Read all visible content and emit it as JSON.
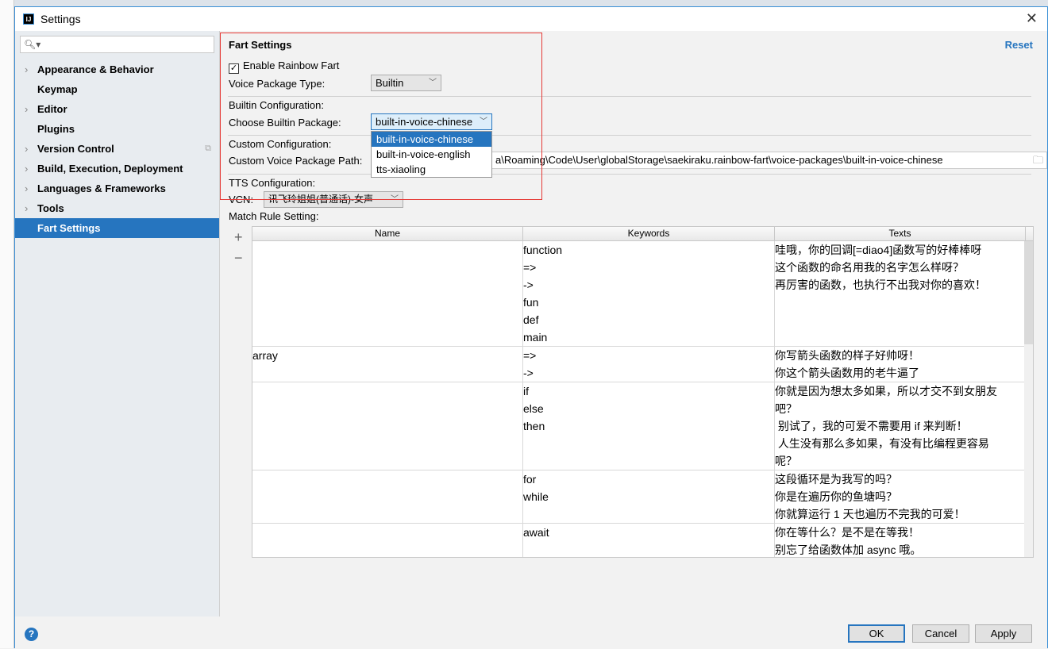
{
  "window": {
    "title": "Settings",
    "app_icon": "IJ"
  },
  "sidebar": {
    "search_placeholder": "",
    "items": [
      {
        "label": "Appearance & Behavior",
        "expandable": true
      },
      {
        "label": "Keymap",
        "expandable": false
      },
      {
        "label": "Editor",
        "expandable": true
      },
      {
        "label": "Plugins",
        "expandable": false
      },
      {
        "label": "Version Control",
        "expandable": true
      },
      {
        "label": "Build, Execution, Deployment",
        "expandable": true
      },
      {
        "label": "Languages & Frameworks",
        "expandable": true
      },
      {
        "label": "Tools",
        "expandable": true
      },
      {
        "label": "Fart Settings",
        "expandable": false,
        "selected": true
      }
    ]
  },
  "main": {
    "section_title": "Fart Settings",
    "reset": "Reset",
    "enable_label": "Enable Rainbow Fart",
    "enable_checked": true,
    "voice_type_label": "Voice Package Type:",
    "voice_type_value": "Builtin",
    "builtin_config_label": "Builtin Configuration:",
    "choose_builtin_label": "Choose Builtin Package:",
    "choose_builtin_value": "built-in-voice-chinese",
    "builtin_options": [
      "built-in-voice-chinese",
      "built-in-voice-english",
      "tts-xiaoling"
    ],
    "custom_config_label": "Custom Configuration:",
    "custom_path_label": "Custom Voice Package Path:",
    "custom_path_value": "a\\Roaming\\Code\\User\\globalStorage\\saekiraku.rainbow-fart\\voice-packages\\built-in-voice-chinese",
    "tts_config_label": "TTS Configuration:",
    "vcn_label": "VCN:",
    "vcn_value": "讯飞玲姐姐(普通话)-女声",
    "match_rule_label": "Match Rule Setting:",
    "add": "+",
    "remove": "−"
  },
  "table": {
    "columns": [
      "Name",
      "Keywords",
      "Texts"
    ],
    "rows": [
      {
        "name": "",
        "keywords": "function\n=>\n->\nfun\ndef\nmain",
        "texts": "哇哦，你的回调[=diao4]函数写的好棒棒呀\n这个函数的命名用我的名字怎么样呀？\n再厉害的函数，也执行不出我对你的喜欢！"
      },
      {
        "name": "array",
        "keywords": "=>\n->",
        "texts": "你写箭头函数的样子好帅呀！\n你这个箭头函数用的老牛逼了"
      },
      {
        "name": "",
        "keywords": "if\nelse\nthen",
        "texts": "你就是因为想太多如果，所以才交不到女朋友\n吧？\n 别试了，我的可爱不需要用 if 来判断！\n 人生没有那么多如果，有没有比编程更容易\n呢？"
      },
      {
        "name": "",
        "keywords": "for\nwhile",
        "texts": "这段循环是为我写的吗？\n你是在遍历你的鱼塘吗？\n你就算运行 1 天也遍历不完我的可爱！"
      },
      {
        "name": "",
        "keywords": "await",
        "texts": "你在等什么？是不是在等我！\n别忘了给函数体加 async 哦。"
      }
    ]
  },
  "footer": {
    "help": "?",
    "ok": "OK",
    "cancel": "Cancel",
    "apply": "Apply"
  }
}
